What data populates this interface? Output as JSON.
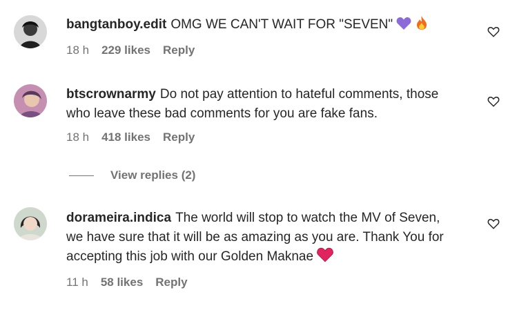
{
  "comments": [
    {
      "username": "bangtanboy.edit",
      "text": "OMG WE CAN'T WAIT FOR \"SEVEN\"",
      "time": "18 h",
      "likes": "229 likes",
      "reply": "Reply",
      "emojis": [
        "purple-heart",
        "fire"
      ]
    },
    {
      "username": "btscrownarmy",
      "text": "Do not pay attention to hateful comments, those who leave these bad comments for you are fake fans.",
      "time": "18 h",
      "likes": "418 likes",
      "reply": "Reply"
    },
    {
      "username": "dorameira.indica",
      "text": "The world will stop to watch the MV of Seven, we have sure that it will be as amazing as you are. Thank You for accepting this job with our Golden Maknae",
      "time": "11 h",
      "likes": "58 likes",
      "reply": "Reply",
      "emojis": [
        "red-heart"
      ]
    }
  ],
  "view_replies": "View replies (2)",
  "colors": {
    "text": "#262626",
    "muted": "#737373",
    "purple_heart": "#8c6ad8",
    "fire": "#f26b1d",
    "red_heart": "#e0245e"
  },
  "icons": {
    "like": "heart-outline-icon"
  }
}
